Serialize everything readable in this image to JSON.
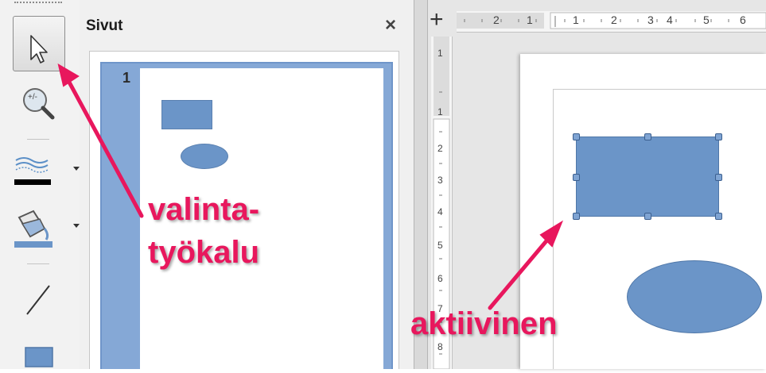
{
  "toolbar": {
    "tools": [
      {
        "name": "select-tool",
        "icon": "arrow-cursor-icon",
        "active": true
      },
      {
        "name": "zoom-pan-tool",
        "icon": "zoom-magnifier-icon"
      },
      {
        "name": "line-style-tool",
        "icon": "line-style-icon",
        "has_dropdown": true
      },
      {
        "name": "fill-tool",
        "icon": "paint-bucket-icon",
        "has_dropdown": true
      },
      {
        "name": "line-tool",
        "icon": "line-icon"
      },
      {
        "name": "rectangle-tool",
        "icon": "rectangle-icon"
      }
    ]
  },
  "panel": {
    "title": "Sivut",
    "close_glyph": "×",
    "slides": [
      {
        "number": "1",
        "shapes": [
          "rectangle",
          "ellipse"
        ]
      }
    ]
  },
  "ruler": {
    "horizontal_labels": [
      "2",
      "1",
      "1",
      "2",
      "3",
      "4",
      "5",
      "6"
    ],
    "vertical_labels": [
      "1",
      "1",
      "2",
      "3",
      "4",
      "5",
      "6",
      "7",
      "8"
    ],
    "corner_glyph": "+"
  },
  "annotations": {
    "tool_label_line1": "valinta-",
    "tool_label_line2": "työkalu",
    "active_label": "aktiivinen",
    "color": "#e8175d"
  },
  "colors": {
    "shape_fill": "#6b95c8",
    "slide_highlight": "#85a8d6"
  }
}
